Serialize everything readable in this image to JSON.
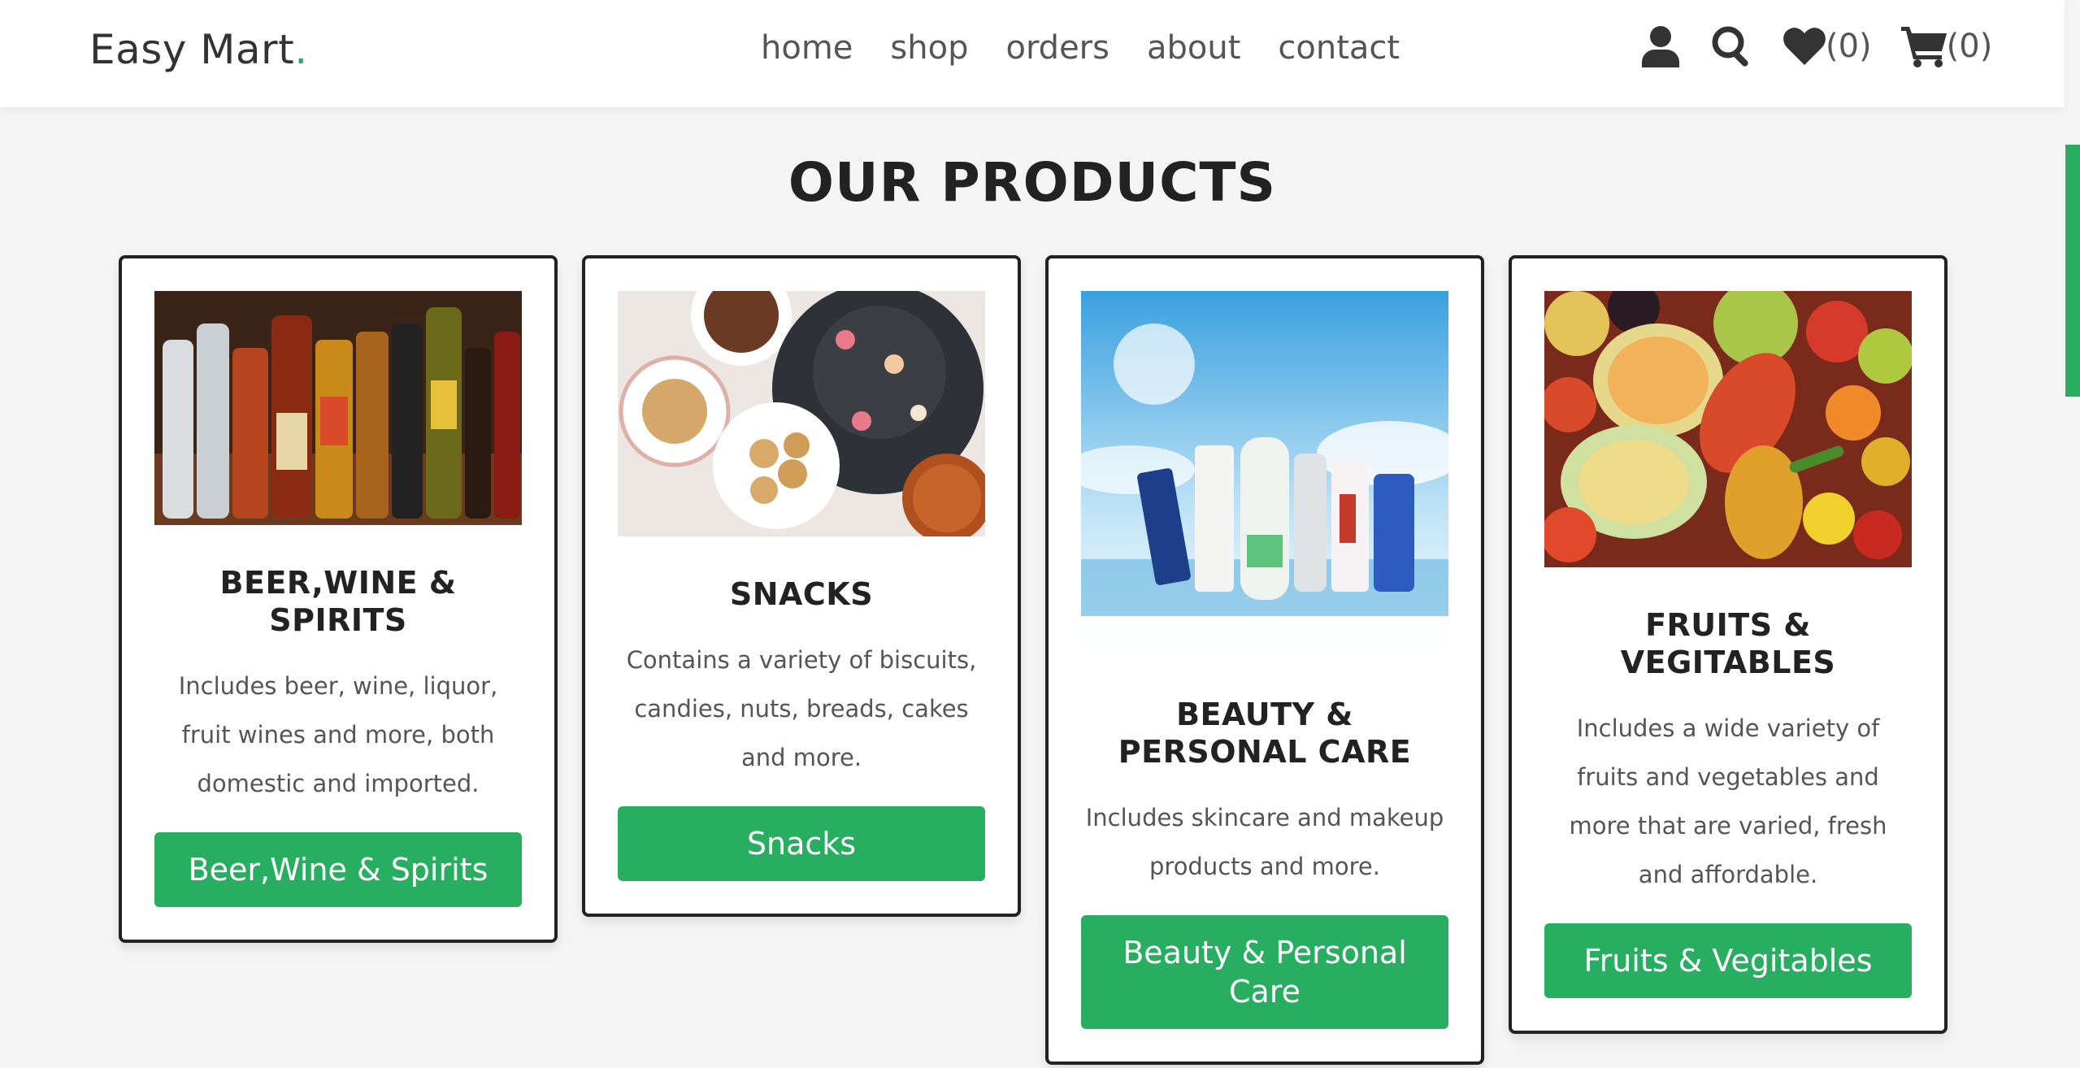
{
  "header": {
    "logo": "Easy Mart",
    "logo_dot": ".",
    "nav": [
      "home",
      "shop",
      "orders",
      "about",
      "contact"
    ],
    "wishlist_count": "(0)",
    "cart_count": "(0)"
  },
  "section_title": "OUR PRODUCTS",
  "products": [
    {
      "title": "BEER,WINE & SPIRITS",
      "description": "Includes beer, wine, liquor, fruit wines and more, both domestic and imported.",
      "button": "Beer,Wine & Spirits"
    },
    {
      "title": "SNACKS",
      "description": "Contains a variety of biscuits, candies, nuts, breads, cakes and more.",
      "button": "Snacks"
    },
    {
      "title": "BEAUTY & PERSONAL CARE",
      "description": "Includes skincare and makeup products and more.",
      "button": "Beauty & Personal Care"
    },
    {
      "title": "FRUITS & VEGITABLES",
      "description": "Includes a wide variety of fruits and vegetables and more that are varied, fresh and affordable.",
      "button": "Fruits & Vegitables"
    }
  ],
  "colors": {
    "accent": "#27ae60",
    "background": "#f5f5f5",
    "text": "#333333"
  },
  "icons": [
    "user-icon",
    "search-icon",
    "heart-icon",
    "cart-icon"
  ]
}
